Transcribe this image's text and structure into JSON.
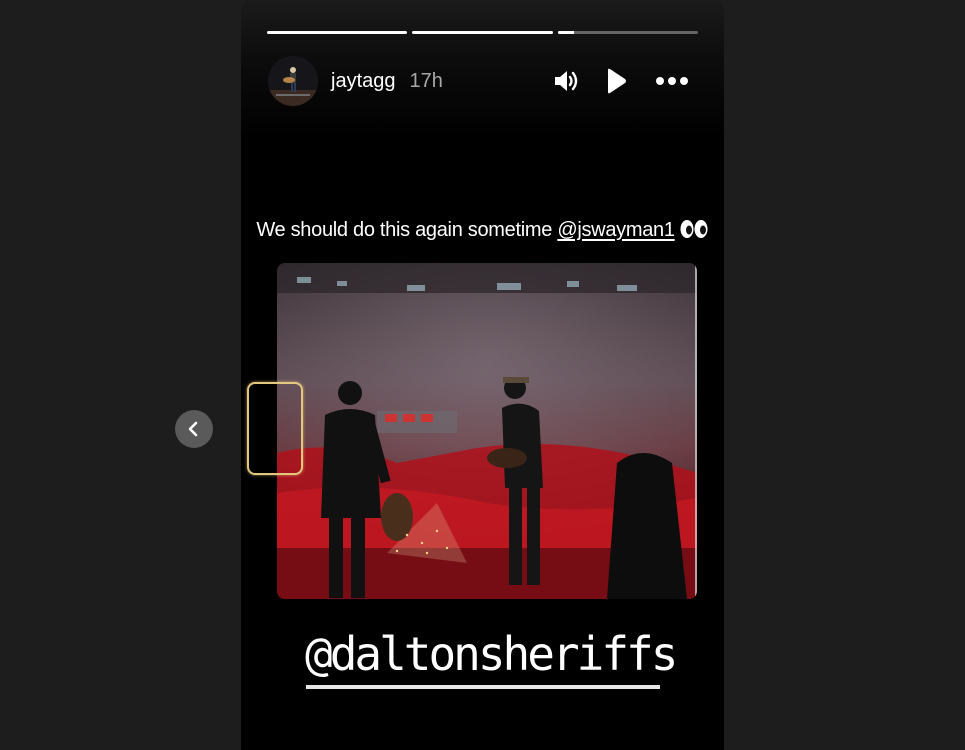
{
  "story": {
    "progress": [
      1.0,
      1.0,
      0.12
    ],
    "username": "jaytagg",
    "time_ago": "17h",
    "controls": {
      "sound_icon": "speaker-icon",
      "play_icon": "play-icon",
      "more_icon": "more-horizontal-icon"
    },
    "caption": {
      "text": "We should do this again sometime ",
      "mention": "@jswayman1",
      "emoji": "eyes-emoji"
    },
    "handle": "@daltonsheriffs"
  },
  "nav": {
    "prev_icon": "chevron-left-icon"
  },
  "colors": {
    "page_bg": "#1d1d1d",
    "story_bg": "#000000",
    "accent_red": "#c0141c",
    "focus_box": "#e3c77d"
  }
}
